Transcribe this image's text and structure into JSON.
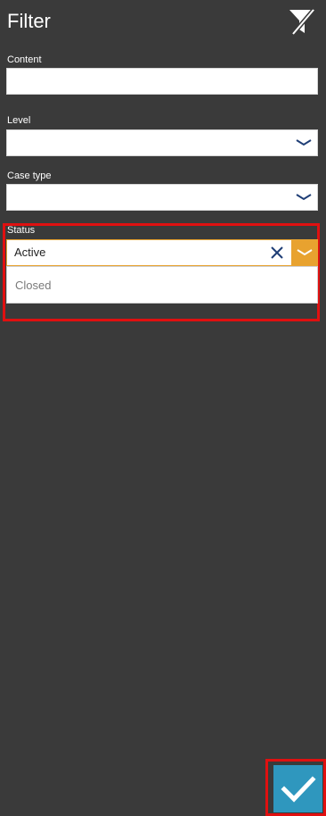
{
  "header": {
    "title": "Filter",
    "clear_icon": "filter-clear-icon"
  },
  "fields": {
    "content": {
      "label": "Content",
      "value": "",
      "placeholder": ""
    },
    "level": {
      "label": "Level",
      "value": ""
    },
    "case_type": {
      "label": "Case type",
      "value": ""
    },
    "status": {
      "label": "Status",
      "value": "Active",
      "options": [
        "Closed"
      ]
    }
  },
  "actions": {
    "apply_icon": "checkmark-icon"
  },
  "colors": {
    "background": "#3a3a3a",
    "accent_orange": "#e8a22f",
    "accent_blue": "#2f97be",
    "highlight_red": "#e01010",
    "icon_navy": "#1f3e76"
  }
}
